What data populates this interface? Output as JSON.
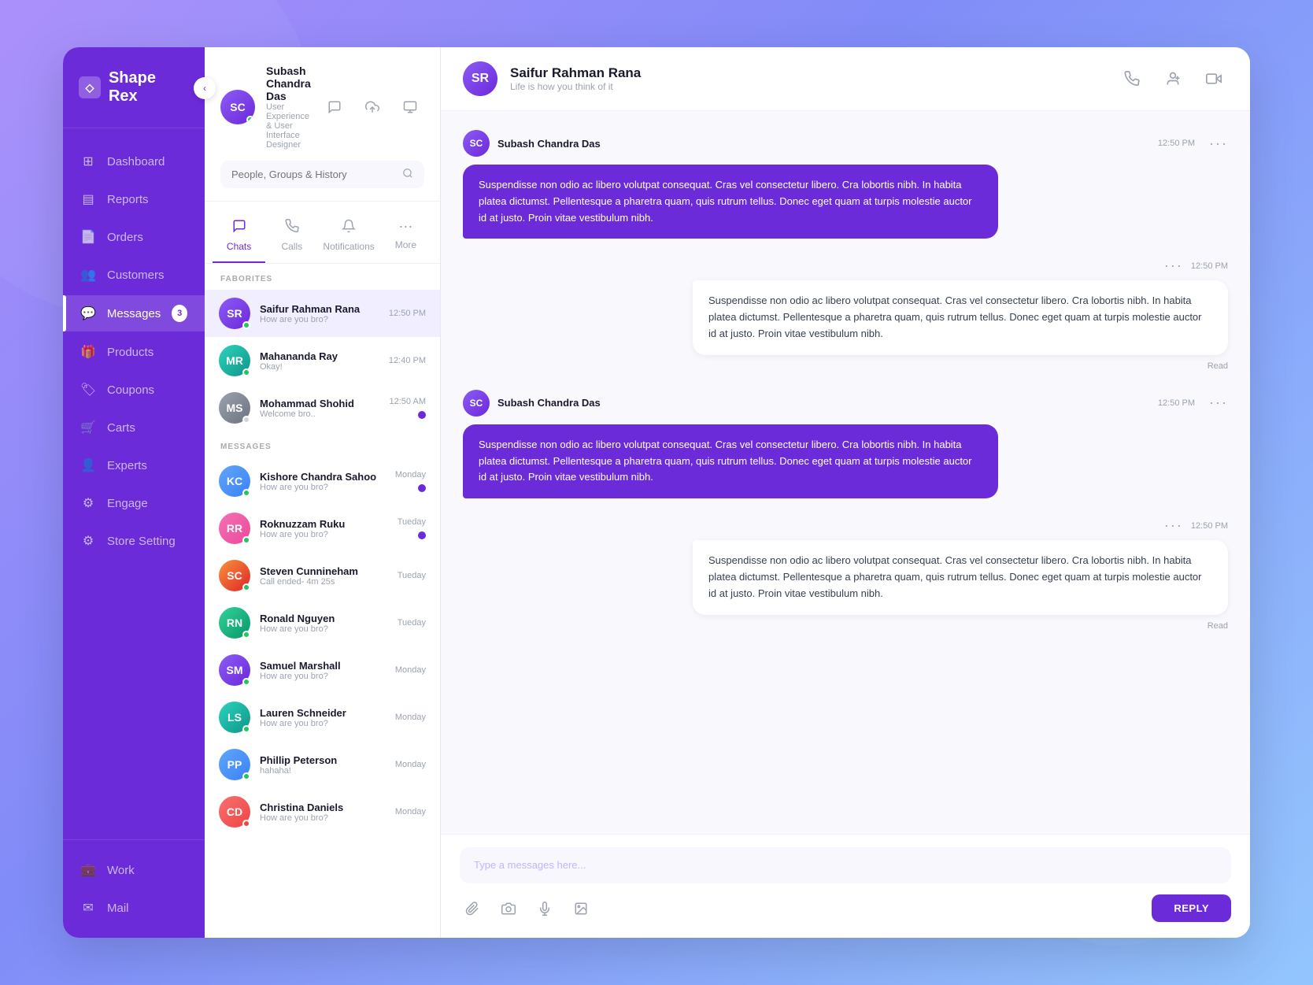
{
  "app": {
    "title": "Shape Rex",
    "collapse_btn": "‹"
  },
  "current_user": {
    "name": "Subash Chandra Das",
    "title": "User Experience & User Interface Designer",
    "initials": "SC",
    "avatar_color": "av-purple"
  },
  "header_icons": {
    "chat": "💬",
    "upload": "↑",
    "monitor": "🖥",
    "power": "⏻"
  },
  "sidebar": {
    "items": [
      {
        "id": "dashboard",
        "label": "Dashboard",
        "icon": "⊞",
        "active": false
      },
      {
        "id": "reports",
        "label": "Reports",
        "icon": "📋",
        "active": false
      },
      {
        "id": "orders",
        "label": "Orders",
        "icon": "📄",
        "active": false
      },
      {
        "id": "customers",
        "label": "Customers",
        "icon": "👥",
        "active": false
      },
      {
        "id": "messages",
        "label": "Messages",
        "icon": "💬",
        "active": true,
        "badge": "3"
      },
      {
        "id": "products",
        "label": "Products",
        "icon": "🎁",
        "active": false
      },
      {
        "id": "coupons",
        "label": "Coupons",
        "icon": "🏷",
        "active": false
      },
      {
        "id": "carts",
        "label": "Carts",
        "icon": "🛒",
        "active": false
      },
      {
        "id": "experts",
        "label": "Experts",
        "icon": "👤",
        "active": false
      },
      {
        "id": "engage",
        "label": "Engage",
        "icon": "⚙",
        "active": false
      },
      {
        "id": "store_setting",
        "label": "Store Setting",
        "icon": "⚙",
        "active": false
      }
    ],
    "bottom_items": [
      {
        "id": "work",
        "label": "Work",
        "icon": "💼"
      },
      {
        "id": "mail",
        "label": "Mail",
        "icon": "✉"
      }
    ]
  },
  "search": {
    "placeholder": "People, Groups & History"
  },
  "chat_tabs": [
    {
      "id": "chats",
      "label": "Chats",
      "icon": "💬",
      "active": true
    },
    {
      "id": "calls",
      "label": "Calls",
      "icon": "📞",
      "active": false
    },
    {
      "id": "notifications",
      "label": "Notifications",
      "icon": "🔔",
      "active": false
    },
    {
      "id": "more",
      "label": "More",
      "icon": "⋯",
      "active": false
    }
  ],
  "favorites_label": "FABORITES",
  "favorites": [
    {
      "name": "Saifur Rahman Rana",
      "preview": "How are you bro?",
      "time": "12:50 PM",
      "status": "online",
      "initials": "SR",
      "color": "av-purple",
      "selected": true
    },
    {
      "name": "Mahananda Ray",
      "preview": "Okay!",
      "time": "12:40 PM",
      "status": "online",
      "initials": "MR",
      "color": "av-teal",
      "selected": false
    },
    {
      "name": "Mohammad Shohid",
      "preview": "Welcome bro..",
      "time": "12:50 AM",
      "status": "offline",
      "initials": "MS",
      "color": "av-gray",
      "unread": true
    }
  ],
  "messages_label": "MESSAGES",
  "contacts": [
    {
      "name": "Kishore Chandra Sahoo",
      "preview": "How are you bro?",
      "time": "Monday",
      "status": "online",
      "initials": "KC",
      "color": "av-blue",
      "unread": true
    },
    {
      "name": "Roknuzzam Ruku",
      "preview": "How are you bro?",
      "time": "Tueday",
      "status": "online",
      "initials": "RR",
      "color": "av-pink",
      "unread": true
    },
    {
      "name": "Steven Cunnineham",
      "preview": "Call ended- 4m 25s",
      "time": "Tueday",
      "status": "online",
      "initials": "SC",
      "color": "av-orange"
    },
    {
      "name": "Ronald Nguyen",
      "preview": "How are you bro?",
      "time": "Tueday",
      "status": "online",
      "initials": "RN",
      "color": "av-green"
    },
    {
      "name": "Samuel Marshall",
      "preview": "How are you bro?",
      "time": "Monday",
      "status": "online",
      "initials": "SM",
      "color": "av-purple"
    },
    {
      "name": "Lauren Schneider",
      "preview": "How are you bro?",
      "time": "Monday",
      "status": "online",
      "initials": "LS",
      "color": "av-teal"
    },
    {
      "name": "Phillip Peterson",
      "preview": "hahaha!",
      "time": "Monday",
      "status": "online",
      "initials": "PP",
      "color": "av-blue"
    },
    {
      "name": "Christina Daniels",
      "preview": "How are you bro?",
      "time": "Monday",
      "status": "red",
      "initials": "CD",
      "color": "av-red"
    }
  ],
  "active_chat": {
    "name": "Saifur Rahman Rana",
    "status": "Life is how you think of it",
    "initials": "SR",
    "color": "av-purple"
  },
  "messages": [
    {
      "id": "msg1",
      "sender": "Subash Chandra Das",
      "time": "12:50 PM",
      "type": "sent",
      "text": "Suspendisse non odio ac libero volutpat consequat. Cras vel consectetur libero. Cra lobortis nibh. In habita platea dictumst. Pellentesque a pharetra quam, quis rutrum tellus. Donec eget quam at turpis molestie auctor id at justo. Proin vitae vestibulum nibh.",
      "reply": {
        "dots": "...",
        "time": "12:50 PM",
        "text": "Suspendisse non odio ac libero volutpat consequat. Cras vel consectetur libero. Cra lobortis nibh. In habita platea dictumst. Pellentesque a pharetra quam, quis rutrum tellus. Donec eget quam at turpis molestie auctor id at justo. Proin vitae vestibulum nibh.",
        "read_status": "Read"
      }
    },
    {
      "id": "msg2",
      "sender": "Subash Chandra Das",
      "time": "12:50 PM",
      "type": "sent",
      "text": "Suspendisse non odio ac libero volutpat consequat. Cras vel consectetur libero. Cra lobortis nibh. In habita platea dictumst. Pellentesque a pharetra quam, quis rutrum tellus. Donec eget quam at turpis molestie auctor id at justo. Proin vitae vestibulum nibh.",
      "reply": {
        "dots": "...",
        "time": "12:50 PM",
        "text": "Suspendisse non odio ac libero volutpat consequat. Cras vel consectetur libero. Cra lobortis nibh. In habita platea dictumst. Pellentesque a pharetra quam, quis rutrum tellus. Donec eget quam at turpis molestie auctor id at justo. Proin vitae vestibulum nibh.",
        "read_status": "Read"
      }
    }
  ],
  "message_input": {
    "placeholder": "Type a messages here...",
    "reply_label": "REPLY"
  },
  "input_tools": [
    "📎",
    "📷",
    "🎤",
    "🖼"
  ]
}
